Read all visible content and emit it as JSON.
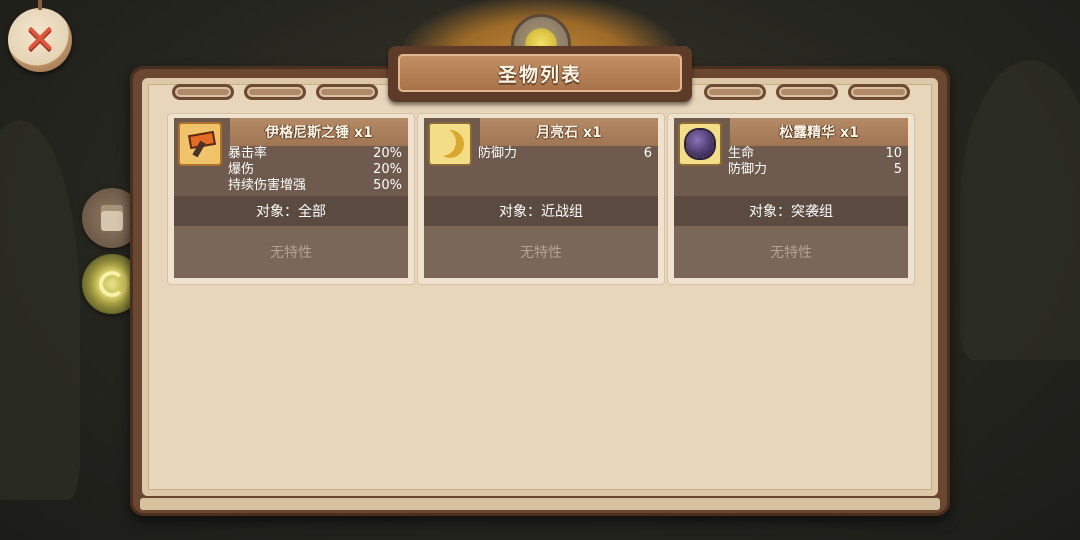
{
  "screen": {
    "title": "圣物列表"
  },
  "close_button": {
    "label": "✕"
  },
  "side_tabs": [
    {
      "name": "book-tab",
      "icon": "book-icon"
    },
    {
      "name": "relic-tab",
      "icon": "swirl-icon",
      "active": true
    }
  ],
  "relics": [
    {
      "name": "伊格尼斯之锤 x1",
      "icon": "hammer-icon",
      "stats": [
        {
          "label": "暴击率",
          "value": "20%"
        },
        {
          "label": "爆伤",
          "value": "20%"
        },
        {
          "label": "持续伤害增强",
          "value": "50%"
        }
      ],
      "target": "对象：全部",
      "trait": "无特性"
    },
    {
      "name": "月亮石 x1",
      "icon": "moon-icon",
      "stats": [
        {
          "label": "防御力",
          "value": "6"
        }
      ],
      "target": "对象：近战组",
      "trait": "无特性"
    },
    {
      "name": "松露精华 x1",
      "icon": "truffle-icon",
      "stats": [
        {
          "label": "生命",
          "value": "10"
        },
        {
          "label": "防御力",
          "value": "5"
        }
      ],
      "target": "对象：突袭组",
      "trait": "无特性"
    }
  ],
  "colors": {
    "frame": "#6b4630",
    "paper": "#e7d6b9",
    "card_body": "#6e5b4d",
    "close_x": "#e0553e"
  }
}
